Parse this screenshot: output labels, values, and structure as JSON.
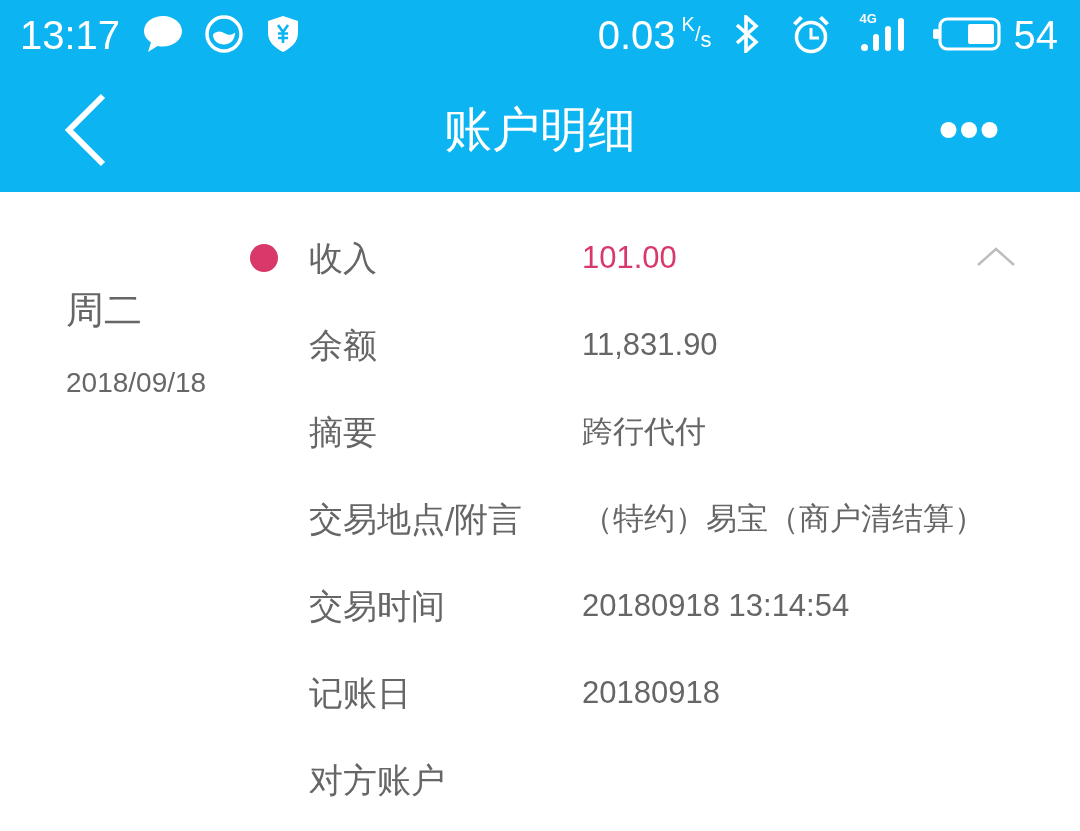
{
  "status_bar": {
    "time": "13:17",
    "net_speed": "0.03",
    "net_speed_unit": "$^{K}$/$_{s}$",
    "network_type": "4G",
    "battery": "54"
  },
  "header": {
    "title": "账户明细"
  },
  "transaction": {
    "weekday": "周二",
    "date": "2018/09/18",
    "color": "#d8386a",
    "expanded": true,
    "amount": {
      "label": "收入",
      "value": "101.00"
    },
    "fields": [
      {
        "label": "余额",
        "value": "11,831.90"
      },
      {
        "label": "摘要",
        "value": "跨行代付"
      },
      {
        "label": "交易地点/附言",
        "value": "（特约）易宝（商户清结算）"
      },
      {
        "label": "交易时间",
        "value": "20180918 13:14:54"
      },
      {
        "label": "记账日",
        "value": "20180918"
      },
      {
        "label": "对方账户"
      }
    ]
  }
}
